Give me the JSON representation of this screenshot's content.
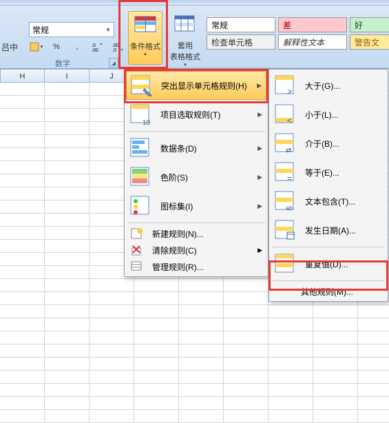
{
  "ribbon": {
    "number_format": "常规",
    "partial_label": "吕中",
    "percent": "%",
    "comma": ",",
    "inc_dec1": ".0",
    "inc_dec2": ".00",
    "group_number": "数字",
    "cond_format": "条件格式",
    "table_format": "套用\n表格格式"
  },
  "styles": {
    "s1": "常规",
    "s2": "差",
    "s3": "好",
    "s4": "检查单元格",
    "s5": "解释性文本",
    "s6": "警告文"
  },
  "cols": [
    "H",
    "I",
    "J"
  ],
  "menu1": {
    "m1": "突出显示单元格规则(H)",
    "m2": "项目选取规则(T)",
    "m3": "数据条(D)",
    "m4": "色阶(S)",
    "m5": "图标集(I)",
    "m6": "新建规则(N)...",
    "m7": "清除规则(C)",
    "m8": "管理规则(R)..."
  },
  "menu2": {
    "m1": "大于(G)...",
    "m2": "小于(L)...",
    "m3": "介于(B)...",
    "m4": "等于(E)...",
    "m5": "文本包含(T)...",
    "m6": "发生日期(A)...",
    "m7": "重复值(D)...",
    "m8": "其他规则(M)..."
  }
}
